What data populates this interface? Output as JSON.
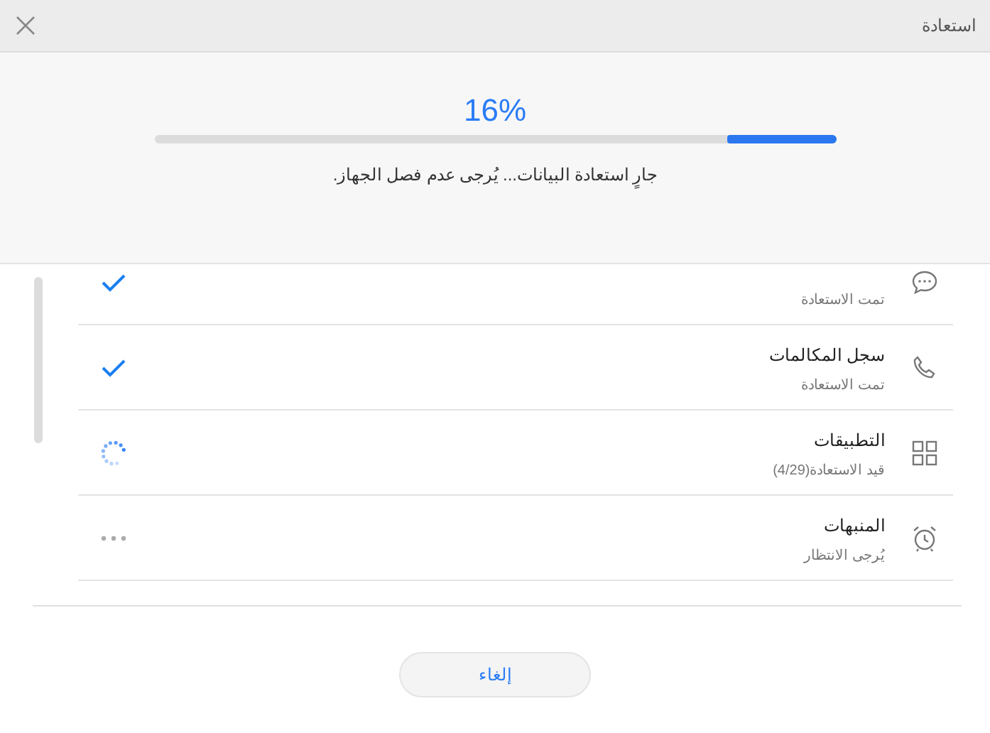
{
  "window": {
    "title": "استعادة"
  },
  "progress": {
    "percent": "16%",
    "level": 0.16,
    "message": "جارٍ استعادة البيانات... يُرجى عدم فصل الجهاز."
  },
  "items": [
    {
      "status_text": "تمت الاستعادة",
      "kind": "done"
    },
    {
      "title": "سجل المكالمات",
      "status_text": "تمت الاستعادة",
      "kind": "done"
    },
    {
      "title": "التطبيقات",
      "status_text": "قيد الاستعادة(4/29)",
      "kind": "progress"
    },
    {
      "title": "المنبهات",
      "status_text": "يُرجى الانتظار",
      "kind": "waiting"
    }
  ],
  "cancel_button": "إلغاء"
}
